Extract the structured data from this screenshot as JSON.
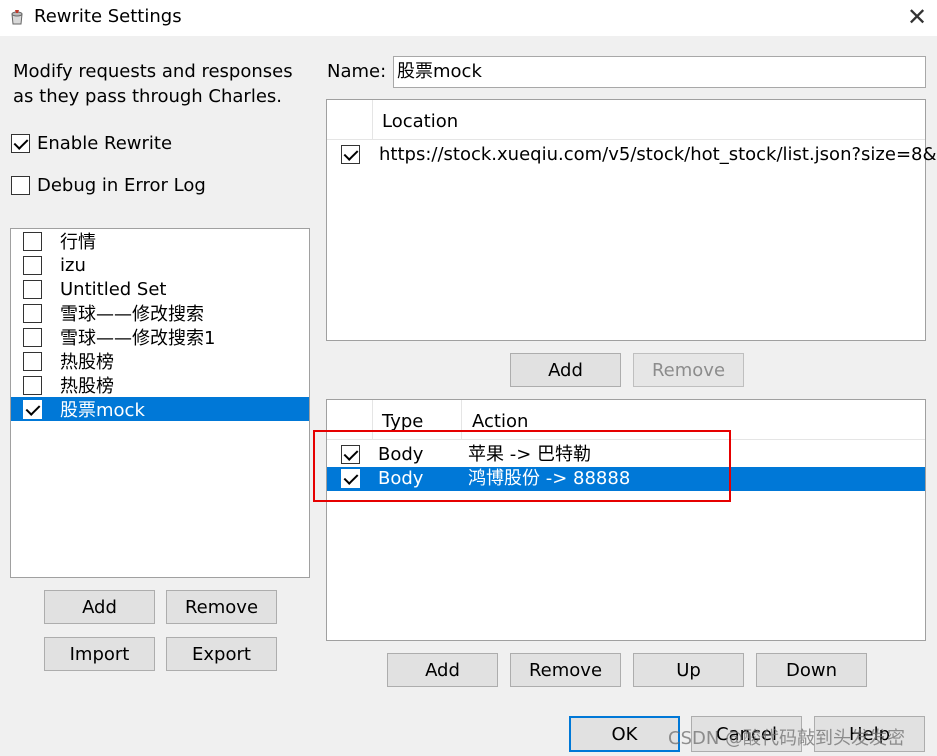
{
  "window": {
    "title": "Rewrite Settings",
    "close_glyph": "✕"
  },
  "left": {
    "description": "Modify requests and responses as they pass through Charles.",
    "enable_rewrite": {
      "label": "Enable Rewrite",
      "checked": true
    },
    "debug_log": {
      "label": "Debug in Error Log",
      "checked": false
    },
    "sets": [
      {
        "label": "行情",
        "checked": false
      },
      {
        "label": "izu",
        "checked": false
      },
      {
        "label": "Untitled Set",
        "checked": false
      },
      {
        "label": "雪球——修改搜索",
        "checked": false
      },
      {
        "label": "雪球——修改搜索1",
        "checked": false
      },
      {
        "label": "热股榜",
        "checked": false
      },
      {
        "label": "热股榜",
        "checked": false
      },
      {
        "label": "股票mock",
        "checked": true,
        "selected": true
      }
    ],
    "buttons": {
      "add": "Add",
      "remove": "Remove",
      "import": "Import",
      "export": "Export"
    }
  },
  "name_field": {
    "label": "Name:",
    "value": "股票mock"
  },
  "locations": {
    "header": "Location",
    "rows": [
      {
        "checked": true,
        "location": "https://stock.xueqiu.com/v5/stock/hot_stock/list.json?size=8&..."
      }
    ],
    "buttons": {
      "add": "Add",
      "remove": "Remove"
    }
  },
  "rules": {
    "headers": {
      "type": "Type",
      "action": "Action"
    },
    "rows": [
      {
        "checked": true,
        "type": "Body",
        "action": "苹果 -> 巴特勒",
        "selected": false
      },
      {
        "checked": true,
        "type": "Body",
        "action": "鸿博股份 -> 88888",
        "selected": true
      }
    ],
    "buttons": {
      "add": "Add",
      "remove": "Remove",
      "up": "Up",
      "down": "Down"
    }
  },
  "dialog_buttons": {
    "ok": "OK",
    "cancel": "Cancel",
    "help": "Help"
  },
  "watermark": "CSDN @酸代码敲到头发发密",
  "colors": {
    "selection": "#0078d7",
    "highlight_box": "#e60000"
  }
}
